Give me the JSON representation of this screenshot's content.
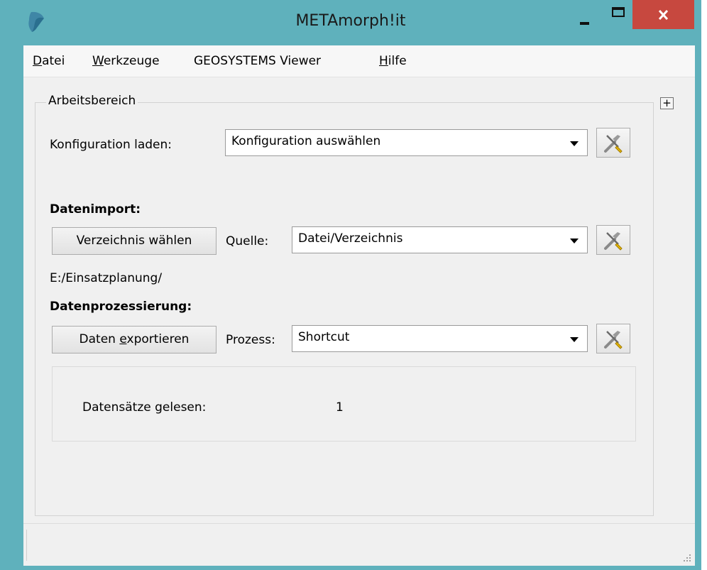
{
  "window": {
    "title": "METAmorph!it"
  },
  "menu": [
    {
      "label_pre": "",
      "label_u": "D",
      "label_post": "atei"
    },
    {
      "label_pre": "",
      "label_u": "W",
      "label_post": "erkzeuge"
    },
    {
      "label_pre": "GEOSYSTEMS Viewer",
      "label_u": "",
      "label_post": ""
    },
    {
      "label_pre": "",
      "label_u": "H",
      "label_post": "ilfe"
    }
  ],
  "workspace": {
    "group_title": "Arbeitsbereich",
    "expand_label": "+",
    "config": {
      "label": "Konfiguration laden:",
      "value": "Konfiguration auswählen"
    },
    "import": {
      "heading": "Datenimport:",
      "button_pre": "Verzeichnis wählen",
      "source_label": "Quelle:",
      "source_value": "Datei/Verzeichnis",
      "path": "E:/Einsatzplanung/"
    },
    "processing": {
      "heading": "Datenprozessierung:",
      "button_pre": "Daten ",
      "button_u": "e",
      "button_post": "xportieren",
      "process_label": "Prozess:",
      "process_value": "Shortcut"
    },
    "stats": {
      "records_label": "Datensätze gelesen:",
      "records_value": "1"
    }
  },
  "icons": {
    "app": "app-logo-icon",
    "tool": "wrench-screwdriver-icon",
    "close": "close-icon",
    "minimize": "minimize-icon",
    "maximize": "maximize-icon"
  },
  "colors": {
    "frame": "#5fb1bc",
    "close_button": "#c7483f",
    "client_bg": "#f0f0f0"
  }
}
